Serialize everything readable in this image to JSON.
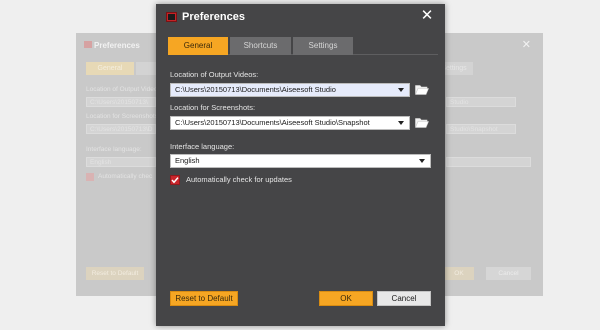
{
  "dialog": {
    "title": "Preferences"
  },
  "tabs": [
    {
      "label": "General",
      "active": true
    },
    {
      "label": "Shortcuts",
      "active": false
    },
    {
      "label": "Settings",
      "active": false
    }
  ],
  "general": {
    "output_videos_label": "Location of Output Videos:",
    "output_videos_value": "C:\\Users\\20150713\\Documents\\Aiseesoft Studio",
    "screenshots_label": "Location for Screenshots:",
    "screenshots_value": "C:\\Users\\20150713\\Documents\\Aiseesoft Studio\\Snapshot",
    "language_label": "Interface language:",
    "language_value": "English",
    "auto_update_label": "Automatically check for updates",
    "auto_update_checked": true
  },
  "buttons": {
    "reset": "Reset to Default",
    "ok": "OK",
    "cancel": "Cancel"
  },
  "ghost": {
    "title": "Preferences",
    "tab_general": "General",
    "tab_settings": "Settings",
    "output_label": "Location of Output Video",
    "output_value": "C:\\Users\\20150713\\",
    "output_tail": "Studio",
    "screens_label": "Location for Screenshots",
    "screens_value": "C:\\Users\\20150713\\D",
    "screens_tail": "Studio\\Snapshot",
    "lang_label": "Interface language:",
    "lang_value": "English",
    "auto_label": "Automatically chec",
    "reset": "Reset to Default",
    "ok": "OK",
    "cancel": "Cancel"
  },
  "colors": {
    "accent": "#f6a623",
    "dialog_bg": "#454547",
    "check": "#c9252b"
  },
  "icons": {
    "app": "app-logo-icon",
    "close": "close-icon",
    "folder": "folder-open-icon",
    "dropdown": "chevron-down-icon",
    "check": "checkmark-icon"
  }
}
